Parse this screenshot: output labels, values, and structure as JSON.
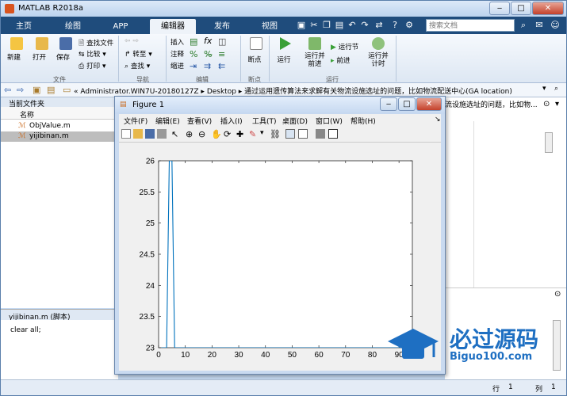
{
  "app": {
    "title": "MATLAB R2018a"
  },
  "colors": {
    "accent": "#1f4c7c",
    "plot_line": "#0072bd",
    "close_btn": "#c4412b"
  },
  "tabs": [
    {
      "label": "主页"
    },
    {
      "label": "绘图"
    },
    {
      "label": "APP"
    },
    {
      "label": "编辑器"
    },
    {
      "label": "发布"
    },
    {
      "label": "视图"
    }
  ],
  "search": {
    "placeholder": "搜索文档"
  },
  "ribbon": {
    "file": {
      "new": "新建",
      "open": "打开",
      "save": "保存",
      "find_files": "查找文件",
      "compare": "比较",
      "print": "打印",
      "section": "文件"
    },
    "nav": {
      "goto": "转至",
      "find": "查找",
      "section": "导航"
    },
    "edit": {
      "insert": "插入",
      "comment": "注释",
      "indent": "缩进",
      "section": "编辑"
    },
    "breakpoints": {
      "label": "断点",
      "section": "断点"
    },
    "run": {
      "run": "运行",
      "run_advance": "运行并\n前进",
      "run_section": "运行节",
      "advance": "前进",
      "run_time": "运行并\n计时",
      "section": "运行"
    }
  },
  "address": {
    "path": "« Administrator.WIN7U-20180127Z  ▸  Desktop  ▸  通过运用遗传算法来求解有关物流设施选址的问题，比如物流配送中心(GA location)"
  },
  "left": {
    "header": "当前文件夹",
    "col_name": "名称",
    "files": [
      {
        "name": "ObjValue.m"
      },
      {
        "name": "yijibinan.m"
      }
    ],
    "details_title": "yijibinan.m  (脚本)",
    "details_code": "clear all;"
  },
  "right": {
    "overflow_text": "流设施选址的问题，比如物..."
  },
  "status": {
    "row_label": "行",
    "row": "1",
    "col_label": "列",
    "col": "1"
  },
  "figure": {
    "title": "Figure 1",
    "menu": [
      "文件(F)",
      "编辑(E)",
      "查看(V)",
      "插入(I)",
      "工具(T)",
      "桌面(D)",
      "窗口(W)",
      "帮助(H)"
    ]
  },
  "chart_data": {
    "type": "line",
    "title": "",
    "xlabel": "",
    "ylabel": "",
    "xlim": [
      0,
      95
    ],
    "ylim": [
      23,
      26
    ],
    "xticks": [
      0,
      10,
      20,
      30,
      40,
      50,
      60,
      70,
      80,
      90
    ],
    "yticks": [
      23,
      23.5,
      24,
      24.5,
      25,
      25.5,
      26
    ],
    "ytick_labels": [
      "23",
      "23.5",
      "24",
      "24.5",
      "25",
      "25.5",
      "26"
    ],
    "series": [
      {
        "x": [
          1,
          2,
          3,
          4,
          5,
          6,
          100
        ],
        "y": [
          23,
          23,
          23,
          26,
          26,
          23,
          23
        ]
      }
    ]
  },
  "watermark": {
    "brand": "必过源码",
    "site": "Biguo100.com"
  }
}
